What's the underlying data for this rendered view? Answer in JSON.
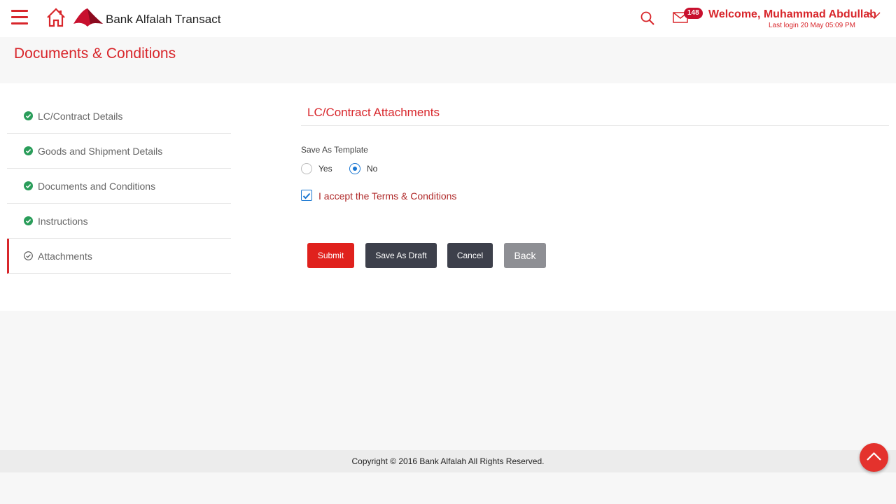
{
  "header": {
    "brand": "Bank Alfalah Transact",
    "notification_count": "148",
    "welcome": "Welcome, Muhammad Abdullah",
    "last_login": "Last login 20 May 05:09 PM",
    "icons": [
      "menu-icon",
      "home-icon",
      "bank-logo",
      "search-icon",
      "mail-icon",
      "chevron-down-icon"
    ]
  },
  "page": {
    "title": "Documents & Conditions"
  },
  "steps": [
    {
      "label": "LC/Contract Details",
      "status": "complete"
    },
    {
      "label": "Goods and Shipment Details",
      "status": "complete"
    },
    {
      "label": "Documents and Conditions",
      "status": "complete"
    },
    {
      "label": "Instructions",
      "status": "complete"
    },
    {
      "label": "Attachments",
      "status": "current"
    }
  ],
  "form": {
    "section_title": "LC/Contract Attachments",
    "template_label": "Save As Template",
    "options": [
      {
        "label": "Yes",
        "selected": false
      },
      {
        "label": "No",
        "selected": true
      }
    ],
    "terms_label": "I accept the Terms & Conditions",
    "terms_checked": true
  },
  "buttons": {
    "submit": "Submit",
    "save_draft": "Save As Draft",
    "cancel": "Cancel",
    "back": "Back"
  },
  "footer": {
    "copyright": "Copyright © 2016 Bank Alfalah All Rights Reserved."
  },
  "colors": {
    "brand_red": "#d8262b",
    "success_green": "#2a9d5a",
    "radio_blue": "#1976d2",
    "dark_button": "#3d404b",
    "muted_button": "#8e8f94"
  }
}
